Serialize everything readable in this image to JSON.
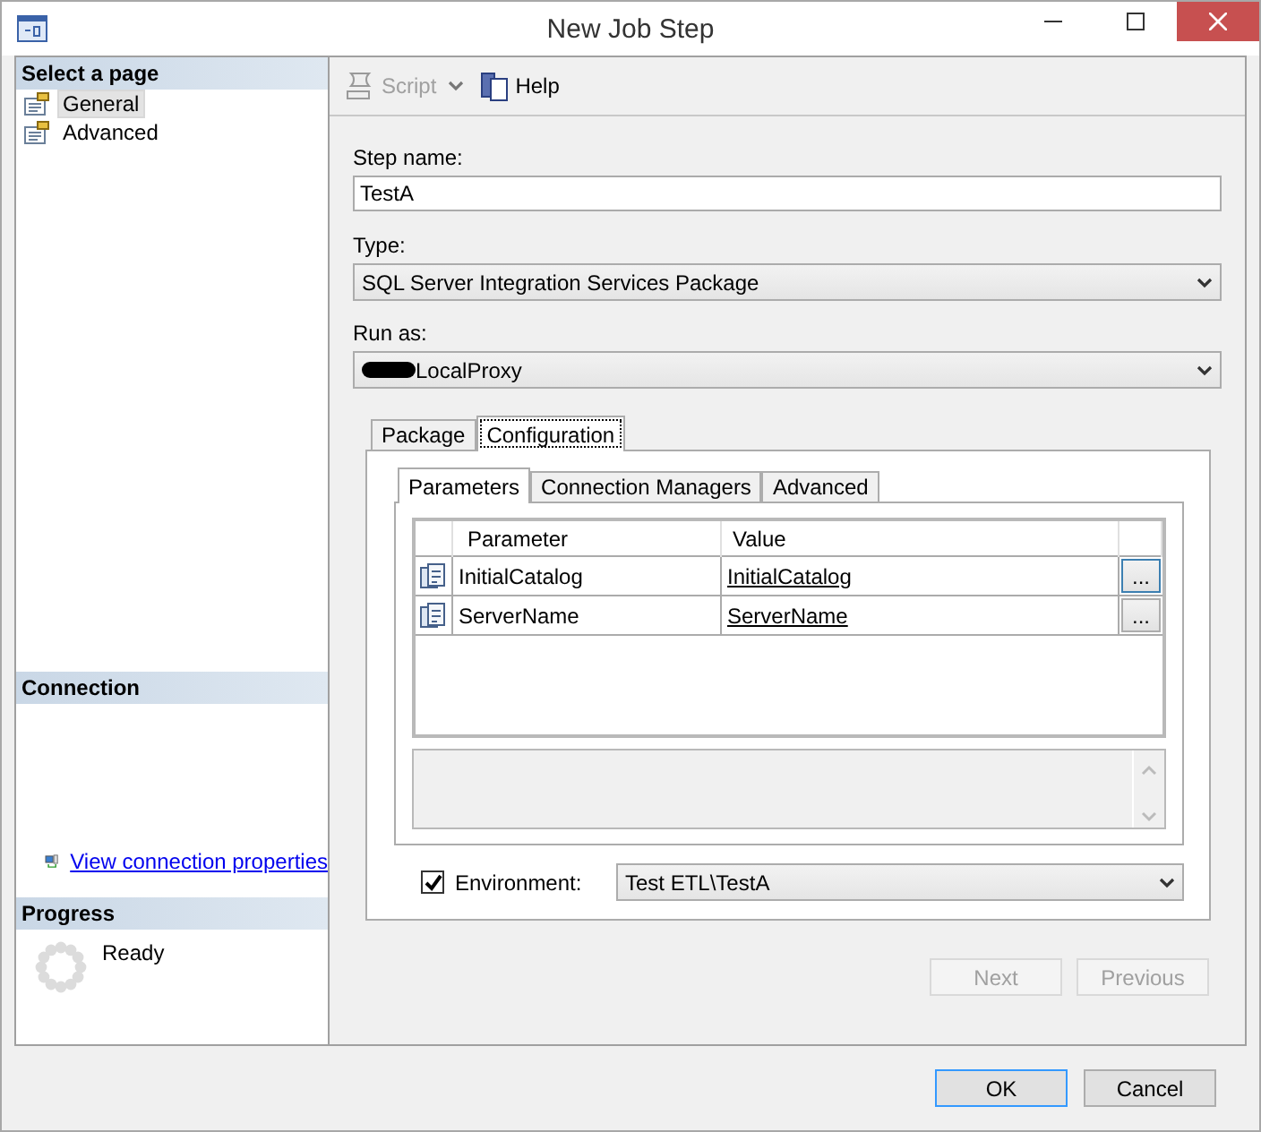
{
  "window": {
    "title": "New Job Step"
  },
  "sidebar": {
    "select_page": {
      "title": "Select a page",
      "items": [
        {
          "label": "General",
          "selected": true
        },
        {
          "label": "Advanced",
          "selected": false
        }
      ]
    },
    "connection": {
      "title": "Connection",
      "link": "View connection properties"
    },
    "progress": {
      "title": "Progress",
      "status": "Ready"
    }
  },
  "toolbar": [
    {
      "label": "Script",
      "kind": "split",
      "disabled": true
    },
    {
      "label": "Help",
      "kind": "plain",
      "disabled": false
    }
  ],
  "form": {
    "step_name": {
      "label": "Step name:",
      "value": "TestA"
    },
    "type": {
      "label": "Type:",
      "value": "SQL Server Integration Services Package"
    },
    "run_as": {
      "label": "Run as:",
      "value": "LocalProxy",
      "redacted": true
    }
  },
  "tabs": [
    {
      "label": "Package",
      "selected": false
    },
    {
      "label": "Configuration",
      "selected": true
    }
  ],
  "subtabs": [
    {
      "label": "Parameters",
      "selected": true
    },
    {
      "label": "Connection Managers",
      "selected": false
    },
    {
      "label": "Advanced",
      "selected": false
    }
  ],
  "parameters": {
    "columns": [
      "Parameter",
      "Value"
    ],
    "rows": [
      {
        "parameter": "InitialCatalog",
        "value": "InitialCatalog",
        "button": "...",
        "focused": true
      },
      {
        "parameter": "ServerName",
        "value": "ServerName",
        "button": "...",
        "focused": false
      }
    ]
  },
  "environment": {
    "checked": true,
    "label": "Environment:",
    "value": "Test ETL\\TestA"
  },
  "nav_buttons": [
    {
      "label": "Next",
      "disabled": true
    },
    {
      "label": "Previous",
      "disabled": true
    }
  ],
  "dialog_buttons": [
    {
      "label": "OK",
      "default": true
    },
    {
      "label": "Cancel",
      "default": false
    }
  ]
}
